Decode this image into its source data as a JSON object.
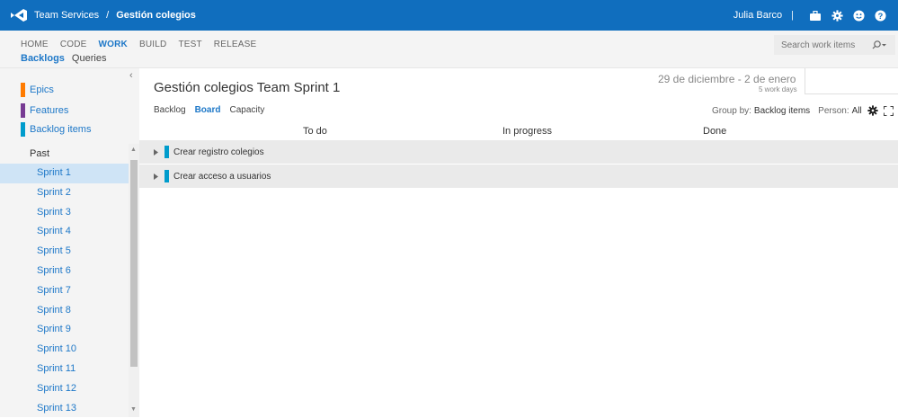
{
  "topbar": {
    "product": "Team Services",
    "separator": "/",
    "project": "Gestión colegios",
    "user": "Julia Barco",
    "divider": "|",
    "icons": [
      "briefcase-icon",
      "gear-icon",
      "smiley-icon",
      "help-icon"
    ],
    "color": "#106ebe"
  },
  "hubs": [
    "HOME",
    "CODE",
    "WORK",
    "BUILD",
    "TEST",
    "RELEASE"
  ],
  "active_hub": "WORK",
  "subhubs": [
    "Backlogs",
    "Queries"
  ],
  "active_subhub": "Backlogs",
  "search": {
    "placeholder": "Search work items"
  },
  "leftpane": {
    "backlogs": [
      {
        "label": "Epics",
        "color": "#ff7b00"
      },
      {
        "label": "Features",
        "color": "#773b93"
      },
      {
        "label": "Backlog items",
        "color": "#009ccc"
      }
    ],
    "past_label": "Past",
    "sprints": [
      "Sprint 1",
      "Sprint 2",
      "Sprint 3",
      "Sprint 4",
      "Sprint 5",
      "Sprint 6",
      "Sprint 7",
      "Sprint 8",
      "Sprint 9",
      "Sprint 10",
      "Sprint 11",
      "Sprint 12",
      "Sprint 13"
    ],
    "selected_sprint": "Sprint 1"
  },
  "main": {
    "title": "Gestión colegios Team Sprint 1",
    "dates": "29 de diciembre - 2 de enero",
    "workdays": "5 work days",
    "pivots": [
      "Backlog",
      "Board",
      "Capacity"
    ],
    "active_pivot": "Board",
    "group_by_label": "Group by:",
    "group_by_value": "Backlog items",
    "person_label": "Person:",
    "person_value": "All",
    "columns": [
      "To do",
      "In progress",
      "Done"
    ],
    "rows": [
      {
        "title": "Crear registro colegios"
      },
      {
        "title": "Crear acceso a usuarios"
      }
    ]
  }
}
